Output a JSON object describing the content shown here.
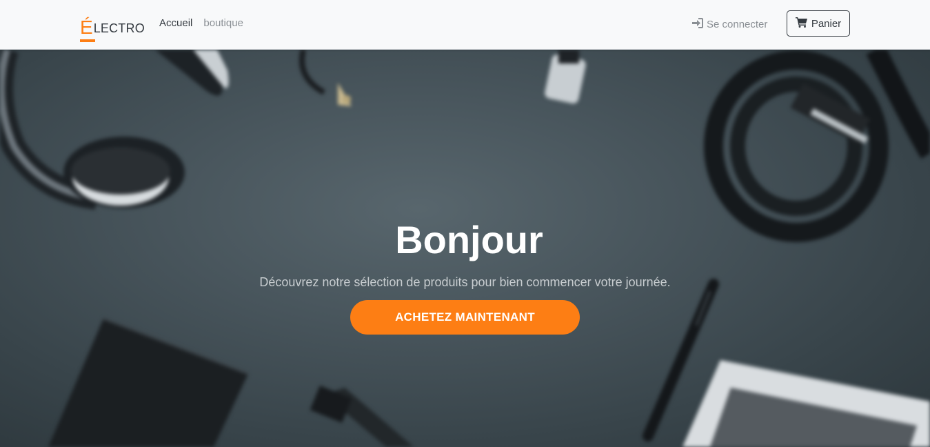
{
  "brand": {
    "first_letter": "É",
    "rest": "LECTRO",
    "accent_color": "#fd7e14"
  },
  "nav": {
    "links": [
      {
        "label": "Accueil",
        "active": true
      },
      {
        "label": "boutique",
        "active": false
      }
    ],
    "login": {
      "icon": "sign-in-icon",
      "label": "Se connecter"
    },
    "cart": {
      "icon": "shopping-cart-icon",
      "label": "Panier"
    }
  },
  "hero": {
    "title": "Bonjour",
    "subtitle": "Découvrez notre sélection de produits pour bien commencer votre journée.",
    "cta_label": "ACHETEZ MAINTENANT",
    "cta_color": "#fd7e14"
  }
}
